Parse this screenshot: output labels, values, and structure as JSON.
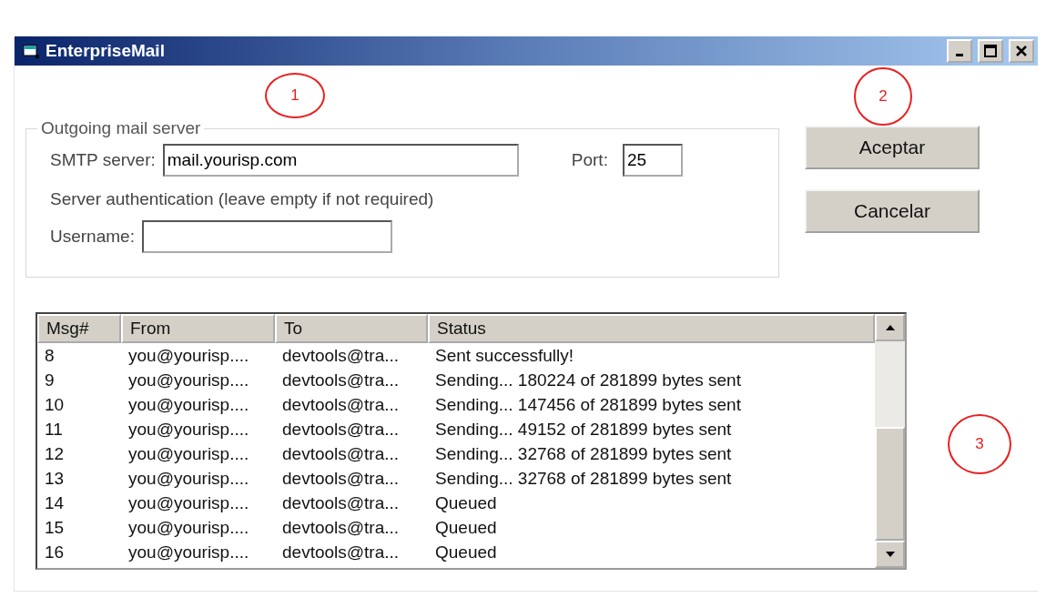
{
  "window": {
    "title": "EnterpriseMail"
  },
  "server_group": {
    "legend": "Outgoing mail server",
    "smtp_label": "SMTP server:",
    "smtp_value": "mail.yourisp.com",
    "port_label": "Port:",
    "port_value": "25",
    "auth_note": "Server authentication (leave empty if not required)",
    "username_label": "Username:"
  },
  "buttons": [
    "Aceptar",
    "Cancelar"
  ],
  "table": {
    "columns": [
      "Msg#",
      "From",
      "To",
      "Status"
    ],
    "rows": [
      [
        "8",
        "you@yourisp....",
        "devtools@tra...",
        "Sent successfully!"
      ],
      [
        "9",
        "you@yourisp....",
        "devtools@tra...",
        "Sending... 180224 of 281899 bytes sent"
      ],
      [
        "10",
        "you@yourisp....",
        "devtools@tra...",
        "Sending... 147456 of 281899 bytes sent"
      ],
      [
        "11",
        "you@yourisp....",
        "devtools@tra...",
        "Sending... 49152 of 281899 bytes sent"
      ],
      [
        "12",
        "you@yourisp....",
        "devtools@tra...",
        "Sending... 32768 of 281899 bytes sent"
      ],
      [
        "13",
        "you@yourisp....",
        "devtools@tra...",
        "Sending... 32768 of 281899 bytes sent"
      ],
      [
        "14",
        "you@yourisp....",
        "devtools@tra...",
        "Queued"
      ],
      [
        "15",
        "you@yourisp....",
        "devtools@tra...",
        "Queued"
      ],
      [
        "16",
        "you@yourisp....",
        "devtools@tra...",
        "Queued"
      ]
    ]
  },
  "callouts": [
    "1",
    "2",
    "3"
  ]
}
